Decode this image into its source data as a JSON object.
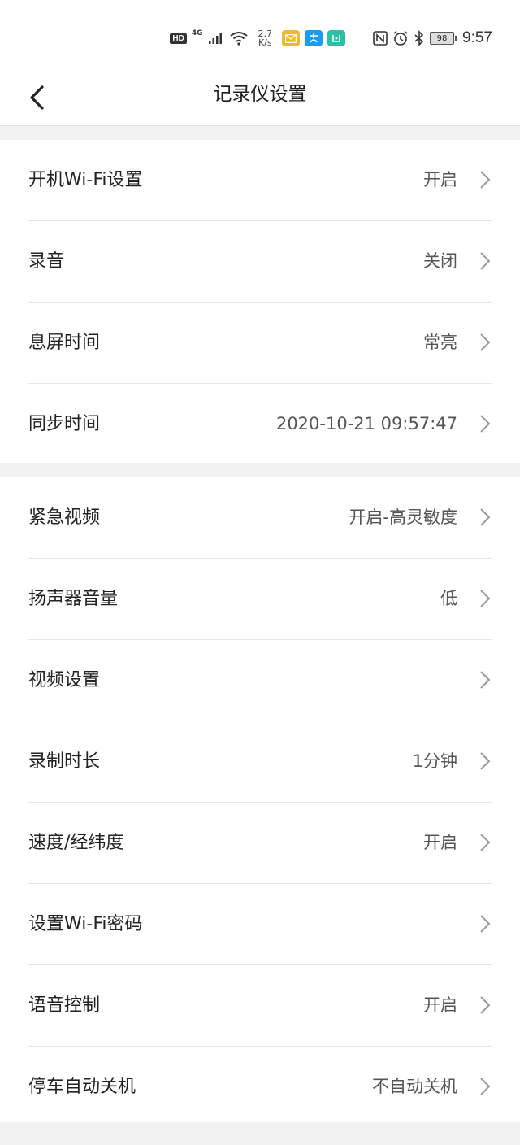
{
  "status_bar": {
    "hd": "HD",
    "network": "4G",
    "speed_value": "2.7",
    "speed_unit": "K/s",
    "battery": "98",
    "time": "9:57",
    "icons": [
      "signal-icon",
      "wifi-icon",
      "mail-app-icon",
      "alipay-app-icon",
      "mijia-app-icon",
      "nfc-icon",
      "alarm-icon",
      "bluetooth-icon",
      "battery-icon"
    ]
  },
  "header": {
    "title": "记录仪设置"
  },
  "section1": {
    "items": [
      {
        "label": "开机Wi-Fi设置",
        "value": "开启"
      },
      {
        "label": "录音",
        "value": "关闭"
      },
      {
        "label": "息屏时间",
        "value": "常亮"
      },
      {
        "label": "同步时间",
        "value": "2020-10-21 09:57:47"
      }
    ]
  },
  "section2": {
    "items": [
      {
        "label": "紧急视频",
        "value": "开启-高灵敏度"
      },
      {
        "label": "扬声器音量",
        "value": "低"
      },
      {
        "label": "视频设置",
        "value": ""
      },
      {
        "label": "录制时长",
        "value": "1分钟"
      },
      {
        "label": "速度/经纬度",
        "value": "开启"
      },
      {
        "label": "设置Wi-Fi密码",
        "value": ""
      },
      {
        "label": "语音控制",
        "value": "开启"
      },
      {
        "label": "停车自动关机",
        "value": "不自动关机"
      }
    ]
  },
  "colors": {
    "background": "#f2f2f2",
    "card": "#ffffff",
    "text": "#222222",
    "secondary_text": "#555555",
    "chevron": "#9a9a9a"
  }
}
